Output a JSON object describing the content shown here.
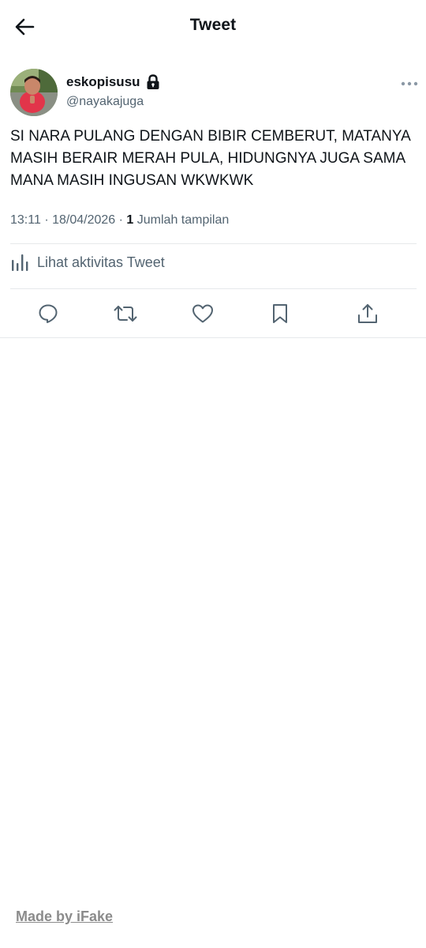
{
  "header": {
    "title": "Tweet",
    "back_icon": "arrow-left-icon"
  },
  "tweet": {
    "user": {
      "display_name": "eskopisusu",
      "handle": "@nayakajuga",
      "protected": true,
      "lock_icon": "lock-icon",
      "avatar_icon": "avatar-photo"
    },
    "more_icon": "more-horizontal-icon",
    "text": "SI NARA PULANG DENGAN BIBIR CEMBERUT, MATANYA MASIH BERAIR MERAH PULA, HIDUNGNYA JUGA SAMA MANA MASIH INGUSAN WKWKWK",
    "time": "13:11",
    "separator": "·",
    "date": "18/04/2026",
    "views_count": "1",
    "views_label": "Jumlah tampilan"
  },
  "activity": {
    "label": "Lihat aktivitas Tweet",
    "icon": "analytics-icon"
  },
  "actions": {
    "reply_icon": "reply-icon",
    "retweet_icon": "retweet-icon",
    "like_icon": "heart-icon",
    "bookmark_icon": "bookmark-icon",
    "share_icon": "share-icon"
  },
  "colors": {
    "text_primary": "#0f1419",
    "text_secondary": "#536471",
    "divider": "#e6e9eb",
    "watermark": "#8b8b8b"
  },
  "watermark": {
    "text": "Made by iFake"
  }
}
